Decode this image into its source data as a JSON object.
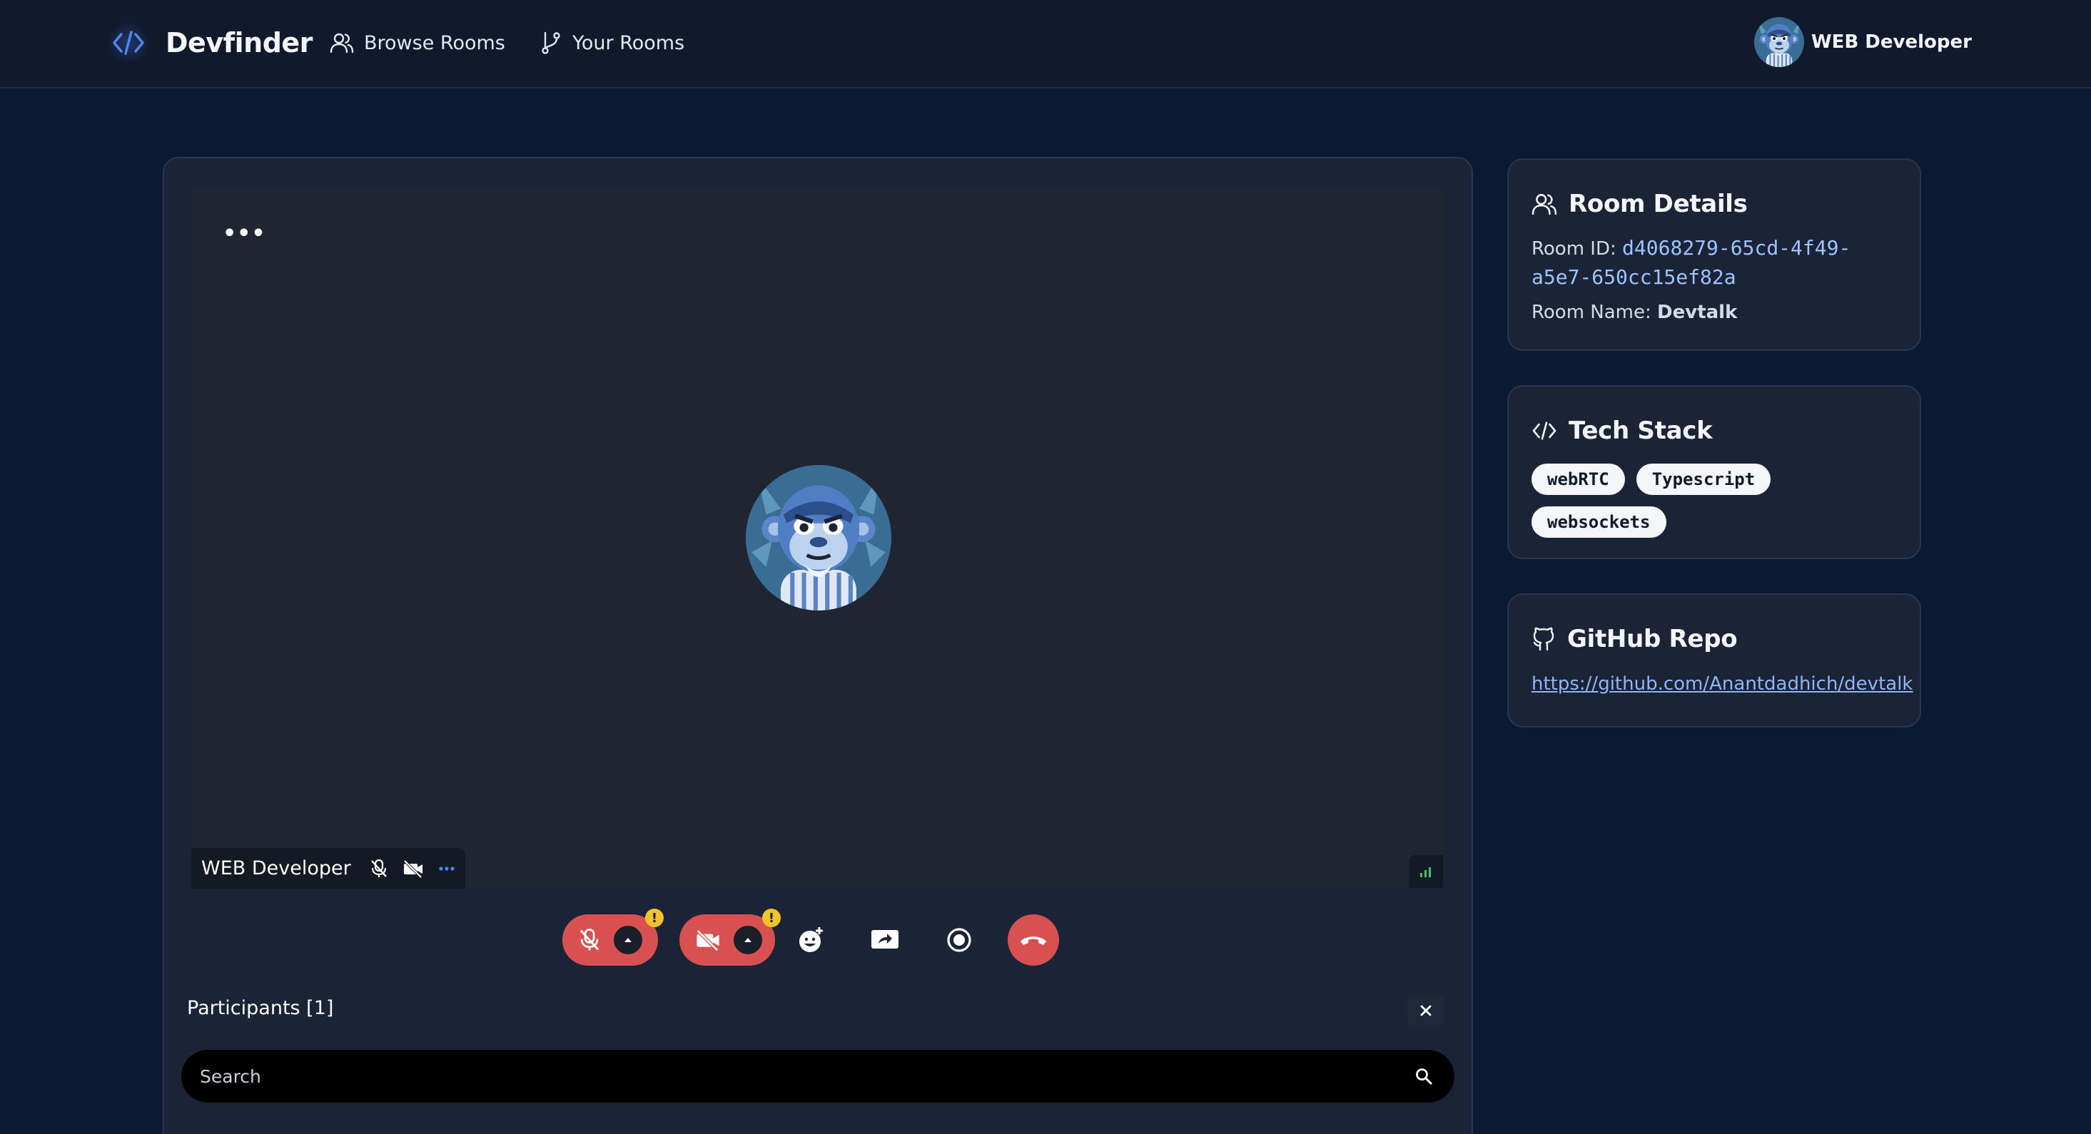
{
  "nav": {
    "brand": "Devfinder",
    "links": [
      {
        "label": "Browse Rooms",
        "icon": "users-icon"
      },
      {
        "label": "Your Rooms",
        "icon": "git-branch-icon"
      }
    ],
    "user_name": "WEB Developer"
  },
  "video": {
    "menu_glyph": "•••",
    "participant_name": "WEB Developer",
    "warning_glyph": "!"
  },
  "controls": {
    "mic": "muted",
    "camera": "off",
    "icons": [
      "mic-off-icon",
      "camera-off-icon",
      "reaction-icon",
      "screen-share-icon",
      "record-icon",
      "end-call-icon"
    ]
  },
  "participants": {
    "title": "Participants [1]",
    "search_placeholder": "Search"
  },
  "room_details": {
    "title": "Room Details",
    "id_label": "Room ID: ",
    "id_line1": "d4068279-65cd-4f49-",
    "id_line2": "a5e7-650cc15ef82a",
    "name_label": "Room Name: ",
    "name_value": "Devtalk"
  },
  "tech_stack": {
    "title": "Tech Stack",
    "tags": [
      "webRTC",
      "Typescript",
      "websockets"
    ]
  },
  "github": {
    "title": "GitHub Repo",
    "url": "https://github.com/Anantdadhich/devtalk"
  },
  "colors": {
    "page_bg": "#0b1a33",
    "nav_bg": "#111a2c",
    "card_bg": "#1b2436",
    "danger": "#d95050",
    "link": "#8fb5f5",
    "warning": "#f2c12e"
  }
}
